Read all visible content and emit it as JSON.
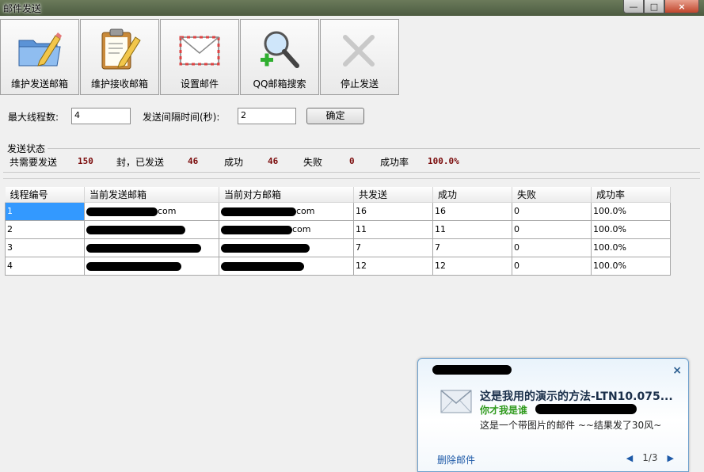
{
  "window": {
    "title": "邮件发送",
    "minimize": "—",
    "maximize": "□",
    "close": "×"
  },
  "toolbar": {
    "buttons": [
      {
        "label": "维护发送邮箱",
        "icon": "folder-edit-icon"
      },
      {
        "label": "维护接收邮箱",
        "icon": "clipboard-edit-icon"
      },
      {
        "label": "设置邮件",
        "icon": "envelope-icon"
      },
      {
        "label": "QQ邮箱搜索",
        "icon": "magnifier-add-icon"
      },
      {
        "label": "停止发送",
        "icon": "close-x-icon"
      }
    ]
  },
  "settings": {
    "max_threads_label": "最大线程数:",
    "max_threads_value": "4",
    "interval_label": "发送间隔时间(秒):",
    "interval_value": "2",
    "confirm_label": "确定"
  },
  "status": {
    "header": "发送状态",
    "total_label": "共需要发送",
    "total_value": "150",
    "sent_label": "封，已发送",
    "sent_value": "46",
    "success_label": "成功",
    "success_value": "46",
    "fail_label": "失败",
    "fail_value": "0",
    "rate_label": "成功率",
    "rate_value": "100.0%"
  },
  "grid": {
    "columns": [
      "线程编号",
      "当前发送邮箱",
      "当前对方邮箱",
      "共发送",
      "成功",
      "失败",
      "成功率"
    ],
    "rows": [
      {
        "id": "1",
        "from_visible": "com",
        "to_visible": "com",
        "total": "16",
        "success": "16",
        "fail": "0",
        "rate": "100.0%"
      },
      {
        "id": "2",
        "from_visible": "",
        "to_visible": "com",
        "total": "11",
        "success": "11",
        "fail": "0",
        "rate": "100.0%"
      },
      {
        "id": "3",
        "from_visible": "",
        "to_visible": "",
        "total": "7",
        "success": "7",
        "fail": "0",
        "rate": "100.0%"
      },
      {
        "id": "4",
        "from_visible": "",
        "to_visible": "",
        "total": "12",
        "success": "12",
        "fail": "0",
        "rate": "100.0%"
      }
    ]
  },
  "notification": {
    "close": "×",
    "subject": "这是我用的演示的方法-LTN10.075...",
    "from_prefix": "你才我是谁",
    "body": "这是一个带图片的邮件 ~~结果发了30风~",
    "delete_label": "删除邮件",
    "page": "1/3",
    "prev": "◀",
    "next": "▶"
  },
  "colors": {
    "selection": "#3399ff",
    "stat_value": "#7a0a0a",
    "link": "#1e5aa8",
    "sender": "#2f9a1d"
  }
}
